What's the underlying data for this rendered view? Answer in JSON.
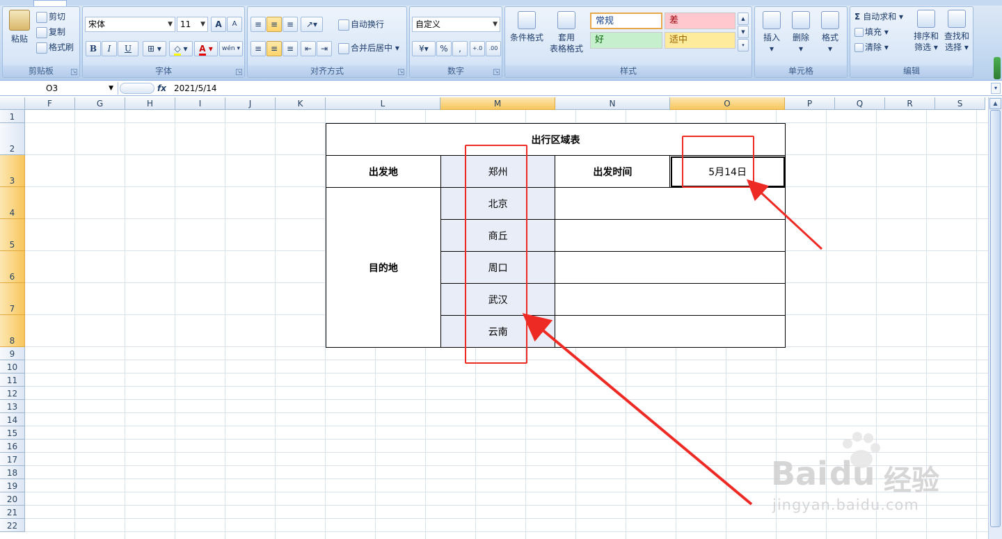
{
  "ribbon": {
    "clipboard": {
      "paste": "粘贴",
      "cut": "剪切",
      "copy": "复制",
      "format_painter": "格式刷",
      "label": "剪贴板"
    },
    "font": {
      "name": "宋体",
      "size": "11",
      "bold": "B",
      "italic": "I",
      "underline": "U",
      "grow": "A",
      "shrink": "A",
      "font_color": "A",
      "phonetic": "wén",
      "label": "字体"
    },
    "alignment": {
      "wrap": "自动换行",
      "merge": "合并后居中",
      "label": "对齐方式"
    },
    "number": {
      "format": "自定义",
      "percent": "%",
      "comma": ",",
      "inc_decimal": "+.0",
      "dec_decimal": ".00",
      "label": "数字"
    },
    "styles": {
      "conditional": "条件格式",
      "table_format_1": "套用",
      "table_format_2": "表格格式",
      "normal": "常规",
      "bad": "差",
      "good": "好",
      "neutral": "适中",
      "label": "样式"
    },
    "cells": {
      "insert": "插入",
      "delete": "删除",
      "format": "格式",
      "label": "单元格"
    },
    "editing": {
      "autosum": "自动求和",
      "fill": "填充",
      "clear": "清除",
      "sort_1": "排序和",
      "sort_2": "筛选",
      "find_1": "查找和",
      "find_2": "选择",
      "label": "编辑"
    }
  },
  "formula_bar": {
    "name_box": "O3",
    "fx": "fx",
    "value": "2021/5/14"
  },
  "columns": [
    "F",
    "G",
    "H",
    "I",
    "J",
    "K",
    "L",
    "M",
    "N",
    "O",
    "P",
    "Q",
    "R",
    "S"
  ],
  "rows": [
    "1",
    "2",
    "3",
    "4",
    "5",
    "6",
    "7",
    "8",
    "9",
    "10",
    "11",
    "12",
    "13",
    "14",
    "15",
    "16",
    "17",
    "18",
    "19",
    "20",
    "21",
    "22"
  ],
  "table": {
    "title": "出行区域表",
    "origin_label": "出发地",
    "origin_value": "郑州",
    "depart_time_label": "出发时间",
    "depart_time_value": "5月14日",
    "destination_label": "目的地",
    "destinations": [
      "北京",
      "商丘",
      "周口",
      "武汉",
      "云南"
    ]
  },
  "watermark": {
    "brand": "Bai",
    "brand2": "du",
    "cn": "经验",
    "url": "jingyan.baidu.com"
  },
  "colors": {
    "annotation": "#ee2a24",
    "selected_header": "#f8c65d",
    "shade_cell": "#e9edf7"
  }
}
